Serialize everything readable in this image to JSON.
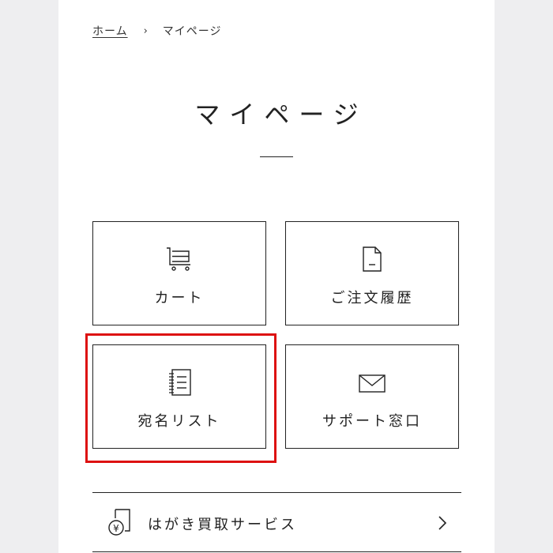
{
  "breadcrumb": {
    "home": "ホーム",
    "separator": "›",
    "current": "マイページ"
  },
  "page": {
    "title": "マイページ"
  },
  "tiles": [
    {
      "label": "カート",
      "icon": "cart-icon"
    },
    {
      "label": "ご注文履歴",
      "icon": "document-icon"
    },
    {
      "label": "宛名リスト",
      "icon": "address-book-icon"
    },
    {
      "label": "サポート窓口",
      "icon": "envelope-icon"
    }
  ],
  "services": [
    {
      "label": "はがき買取サービス",
      "icon": "yen-postcard-icon"
    }
  ],
  "colors": {
    "highlight": "#dd1111",
    "border": "#222222",
    "background": "#eeeef0"
  }
}
